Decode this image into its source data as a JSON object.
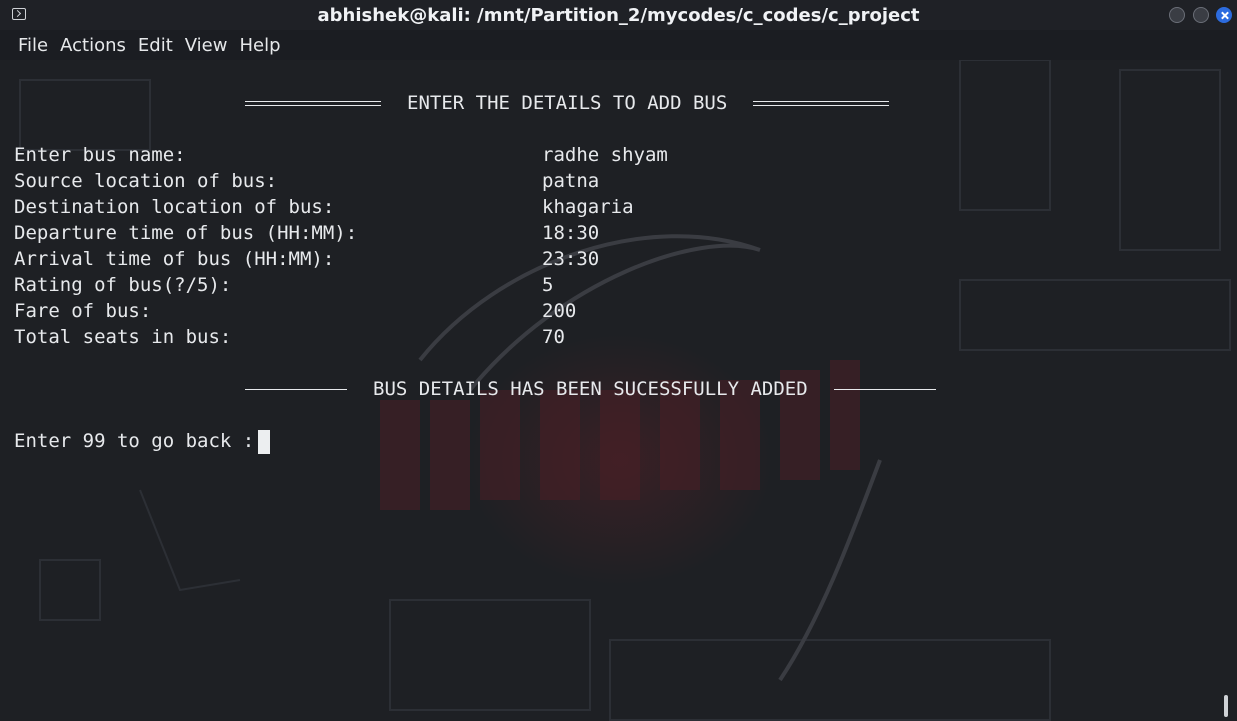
{
  "window": {
    "title": "abhishek@kali: /mnt/Partition_2/mycodes/c_codes/c_project"
  },
  "menu": [
    "File",
    "Actions",
    "Edit",
    "View",
    "Help"
  ],
  "terminal": {
    "header": "ENTER THE DETAILS TO ADD BUS",
    "fields": [
      {
        "label": "Enter bus name:",
        "value": "radhe shyam"
      },
      {
        "label": "Source location of bus:",
        "value": "patna"
      },
      {
        "label": "Destination location of bus:",
        "value": "khagaria"
      },
      {
        "label": "Departure time of bus (HH:MM):",
        "value": "18:30"
      },
      {
        "label": "Arrival time of bus (HH:MM):",
        "value": "23:30"
      },
      {
        "label": "Rating of bus(?/5):",
        "value": "5"
      },
      {
        "label": "Fare of bus:",
        "value": "200"
      },
      {
        "label": "Total seats in bus:",
        "value": "70"
      }
    ],
    "success": "BUS DETAILS HAS BEEN SUCESSFULLY ADDED",
    "prompt": "Enter 99 to go back :"
  }
}
